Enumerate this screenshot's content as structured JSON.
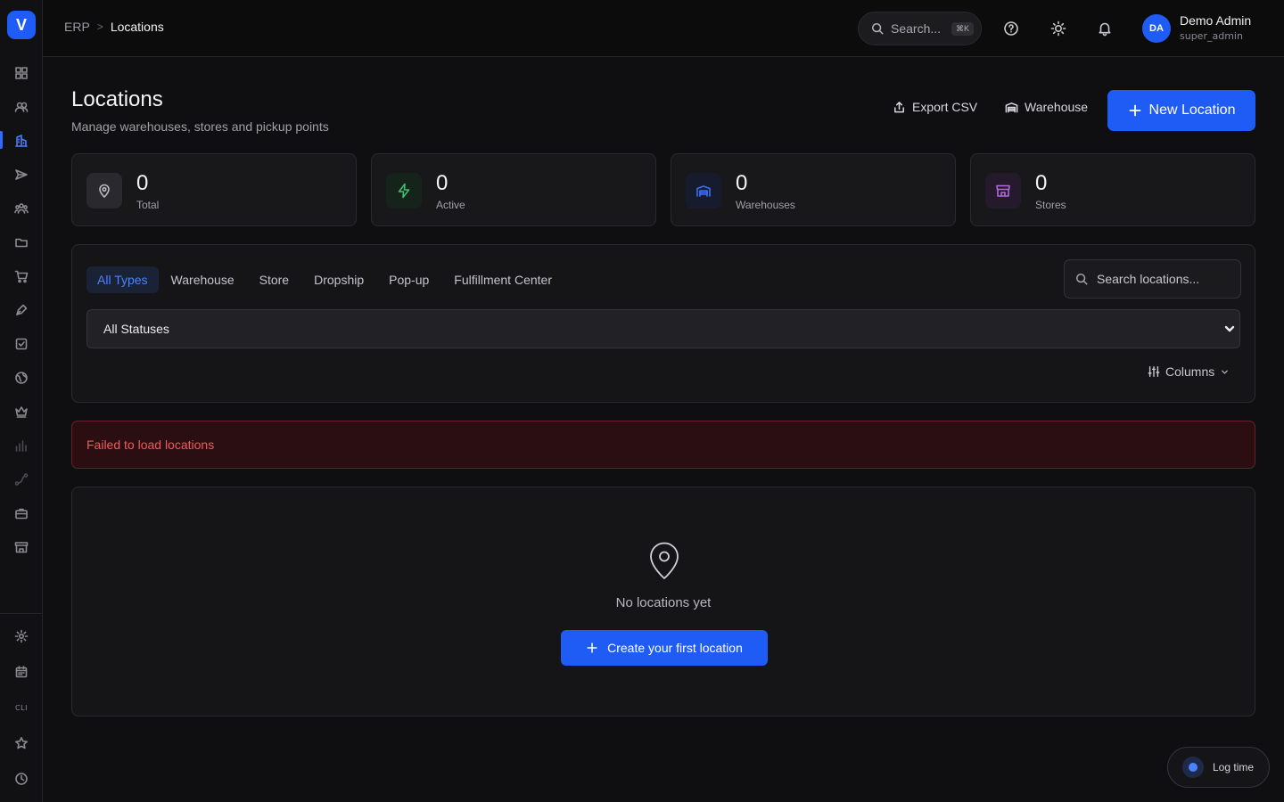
{
  "app": {
    "logo_letter": "V"
  },
  "sidebar": {
    "items": [
      {
        "name": "dashboard",
        "icon": "grid-icon"
      },
      {
        "name": "users",
        "icon": "users-icon"
      },
      {
        "name": "locations",
        "icon": "building-icon",
        "active": true
      },
      {
        "name": "shipping",
        "icon": "send-icon"
      },
      {
        "name": "teams",
        "icon": "group-icon"
      },
      {
        "name": "files",
        "icon": "folder-icon"
      },
      {
        "name": "orders",
        "icon": "cart-icon"
      },
      {
        "name": "design",
        "icon": "pen-icon"
      },
      {
        "name": "tasks",
        "icon": "checkbox-icon"
      },
      {
        "name": "global",
        "icon": "globe-icon"
      },
      {
        "name": "premium",
        "icon": "crown-icon"
      },
      {
        "name": "analytics",
        "icon": "bar-chart-icon"
      },
      {
        "name": "integrations",
        "icon": "route-icon"
      },
      {
        "name": "jobs",
        "icon": "briefcase-icon"
      },
      {
        "name": "stores",
        "icon": "store-icon"
      }
    ],
    "bottom": {
      "settings": "gear-icon",
      "calendar": "calendar-icon",
      "cli_label": "CLI",
      "favorites": "star-icon",
      "history": "clock-icon"
    }
  },
  "topbar": {
    "breadcrumb": {
      "root": "ERP",
      "separator": ">",
      "current": "Locations"
    },
    "search": {
      "placeholder": "Search...",
      "shortcut": "⌘K"
    },
    "user": {
      "initials": "DA",
      "name": "Demo Admin",
      "role": "super_admin"
    }
  },
  "page": {
    "title": "Locations",
    "subtitle": "Manage warehouses, stores and pickup points",
    "actions": {
      "export": "Export CSV",
      "warehouse": "Warehouse",
      "new": "New Location"
    }
  },
  "stats": [
    {
      "value": "0",
      "label": "Total",
      "icon": "map-pin-icon",
      "color": "#b8b8c0",
      "bg": "#2a2a2e"
    },
    {
      "value": "0",
      "label": "Active",
      "icon": "lightning-icon",
      "color": "#3fbf6a",
      "bg": "#16231b"
    },
    {
      "value": "0",
      "label": "Warehouses",
      "icon": "warehouse-icon",
      "color": "#3b6ff5",
      "bg": "#161c2e"
    },
    {
      "value": "0",
      "label": "Stores",
      "icon": "store-icon",
      "color": "#b06ad8",
      "bg": "#241a2c"
    }
  ],
  "filters": {
    "type_tabs": [
      "All Types",
      "Warehouse",
      "Store",
      "Dropship",
      "Pop-up",
      "Fulfillment Center"
    ],
    "selected_tab": "All Types",
    "search_placeholder": "Search locations...",
    "status_value": "All Statuses",
    "columns_label": "Columns"
  },
  "error": {
    "message": "Failed to load locations"
  },
  "empty_state": {
    "text": "No locations yet",
    "button": "Create your first location"
  },
  "log_time": {
    "label": "Log time"
  },
  "colors": {
    "accent": "#1f5cf5",
    "error_text": "#f15a5a",
    "error_bg": "#2a0e12"
  }
}
